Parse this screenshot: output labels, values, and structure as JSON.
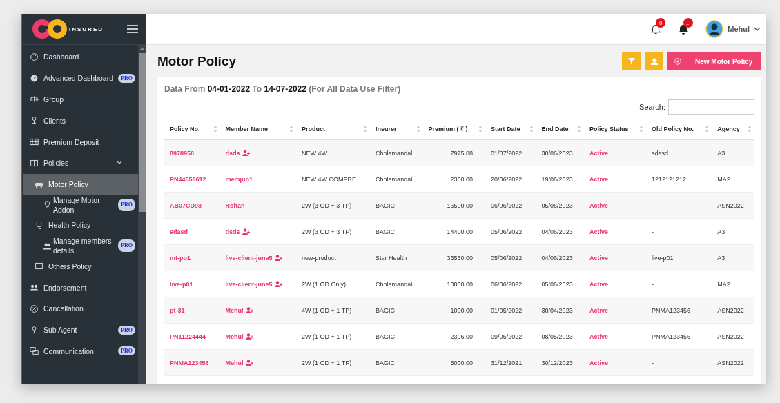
{
  "sidebar": {
    "logo_text": "INSURED",
    "items": [
      {
        "label": "Dashboard",
        "selected": false
      },
      {
        "label": "Advanced Dashboard",
        "badge": "PRO",
        "selected": false
      },
      {
        "label": "Group",
        "selected": false
      },
      {
        "label": "Clients",
        "selected": false
      },
      {
        "label": "Premium Deposit",
        "selected": false
      },
      {
        "label": "Policies",
        "selected": false,
        "expanded": true,
        "children": [
          {
            "label": "Motor Policy",
            "selected": true,
            "children": [
              {
                "label": "Manage Motor Addon",
                "badge": "PRO",
                "selected": false
              }
            ]
          },
          {
            "label": "Health Policy",
            "selected": false,
            "children": [
              {
                "label": "Manage members details",
                "badge": "PRO",
                "selected": false
              }
            ]
          },
          {
            "label": "Others Policy",
            "selected": false
          }
        ]
      },
      {
        "label": "Endorsement",
        "selected": false
      },
      {
        "label": "Cancellation",
        "selected": false
      },
      {
        "label": "Sub Agent",
        "badge": "PRO",
        "selected": false
      },
      {
        "label": "Communication",
        "badge": "PRO",
        "selected": false
      }
    ]
  },
  "topbar": {
    "notifications": [
      {
        "kind": "outline",
        "count": "0"
      },
      {
        "kind": "filled",
        "count": "..."
      }
    ],
    "user": "Mehul"
  },
  "page": {
    "title": "Motor Policy",
    "new_button": "New Motor Policy",
    "range": "Data From **04-01-2022** To **14-07-2022** (For All Data Use Filter)",
    "search_label": "Search:",
    "table": {
      "columns": [
        "Policy No.",
        "Member Name",
        "Product",
        "Insurer",
        "Premium ( ₹ )",
        "Start Date",
        "End Date",
        "Policy Status",
        "Old Policy No.",
        "Agency"
      ],
      "rows": [
        {
          "policy_no": "8978956",
          "member": "dsds",
          "member_icon": true,
          "product": "NEW 4W",
          "insurer": "Cholamandal",
          "premium": "7975.88",
          "start": "01/07/2022",
          "end": "30/06/2023",
          "status": "Active",
          "old_policy": "sdasd",
          "agency": "A3"
        },
        {
          "policy_no": "PN44556612",
          "member": "memjun1",
          "member_icon": false,
          "product": "NEW 4W COMPRE",
          "insurer": "Cholamandal",
          "premium": "2300.00",
          "start": "20/06/2022",
          "end": "19/06/2023",
          "status": "Active",
          "old_policy": "1212121212",
          "agency": "MA2"
        },
        {
          "policy_no": "AB07CD08",
          "member": "Rohan",
          "member_icon": false,
          "product": "2W (3 OD + 3 TP)",
          "insurer": "BAGIC",
          "premium": "16500.00",
          "start": "06/06/2022",
          "end": "05/06/2023",
          "status": "Active",
          "old_policy": "-",
          "agency": "ASN2022"
        },
        {
          "policy_no": "sdasd",
          "member": "dsds",
          "member_icon": true,
          "product": "2W (3 OD + 3 TP)",
          "insurer": "BAGIC",
          "premium": "14400.00",
          "start": "05/06/2022",
          "end": "04/06/2023",
          "status": "Active",
          "old_policy": "-",
          "agency": "A3"
        },
        {
          "policy_no": "mt-po1",
          "member": "live-client-june5",
          "member_icon": true,
          "product": "new-product",
          "insurer": "Star Health",
          "premium": "36560.00",
          "start": "05/06/2022",
          "end": "04/06/2023",
          "status": "Active",
          "old_policy": "live-p01",
          "agency": "A3"
        },
        {
          "policy_no": "live-p01",
          "member": "live-client-june5",
          "member_icon": true,
          "product": "2W (1 OD Only)",
          "insurer": "Cholamandal",
          "premium": "10000.00",
          "start": "06/06/2022",
          "end": "05/06/2023",
          "status": "Active",
          "old_policy": "-",
          "agency": "MA2"
        },
        {
          "policy_no": "pt-31",
          "member": "Mehul",
          "member_icon": true,
          "product": "4W (1 OD + 1 TP)",
          "insurer": "BAGIC",
          "premium": "1000.00",
          "start": "01/05/2022",
          "end": "30/04/2023",
          "status": "Active",
          "old_policy": "PNMA123456",
          "agency": "ASN2022"
        },
        {
          "policy_no": "PN11224444",
          "member": "Mehul",
          "member_icon": true,
          "product": "2W (1 OD + 1 TP)",
          "insurer": "BAGIC",
          "premium": "2306.00",
          "start": "09/05/2022",
          "end": "08/05/2023",
          "status": "Active",
          "old_policy": "PNMA123456",
          "agency": "ASN2022"
        },
        {
          "policy_no": "PNMA123456",
          "member": "Mehul",
          "member_icon": true,
          "product": "2W (1 OD + 1 TP)",
          "insurer": "BAGIC",
          "premium": "5000.00",
          "start": "31/12/2021",
          "end": "30/12/2023",
          "status": "Active",
          "old_policy": "-",
          "agency": "ASN2022"
        }
      ]
    }
  }
}
